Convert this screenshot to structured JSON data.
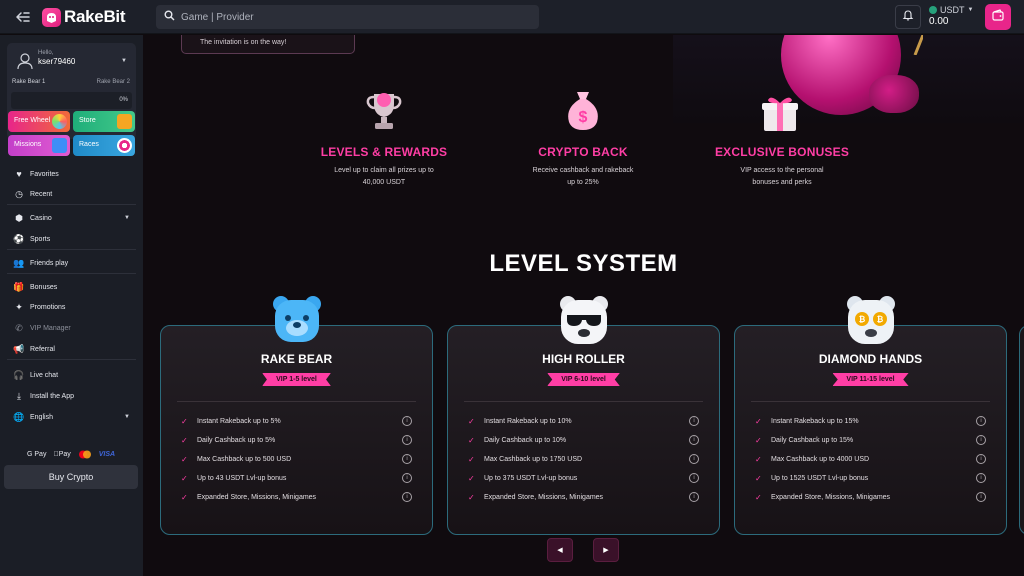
{
  "header": {
    "brand": "RakeBit",
    "search_placeholder": "Game | Provider",
    "currency": "USDT",
    "balance": "0.00"
  },
  "user": {
    "greeting": "Hello,",
    "username": "kser79460",
    "level_current": "Rake Bear 1",
    "level_next": "Rake Bear 2",
    "progress_pct": "0%",
    "progress_value": 0
  },
  "promos": {
    "free_wheel": "Free Wheel",
    "store": "Store",
    "missions": "Missions",
    "races": "Races"
  },
  "nav": {
    "favorites": "Favorites",
    "recent": "Recent",
    "casino": "Casino",
    "sports": "Sports",
    "friends_play": "Friends play",
    "bonuses": "Bonuses",
    "promotions": "Promotions",
    "vip_manager": "VIP Manager",
    "referral": "Referral",
    "live_chat": "Live chat",
    "install_app": "Install the App",
    "language": "English"
  },
  "payments": {
    "gpay": "G Pay",
    "applepay": "Pay",
    "visa": "VISA"
  },
  "buy_crypto": "Buy Crypto",
  "invite_text": "The invitation is on the way!",
  "features": [
    {
      "title": "LEVELS & REWARDS",
      "desc": "Level up to claim all prizes up to 40,000 USDT",
      "icon": "trophy-icon"
    },
    {
      "title": "CRYPTO BACK",
      "desc": "Receive cashback and rakeback up to 25%",
      "icon": "money-bag-icon"
    },
    {
      "title": "EXCLUSIVE BONUSES",
      "desc": "VIP access to the personal bonuses and perks",
      "icon": "gift-icon"
    }
  ],
  "level_system_title": "LEVEL SYSTEM",
  "tiers": [
    {
      "name": "RAKE BEAR",
      "badge": "VIP 1-5 level",
      "perks": [
        "Instant Rakeback up to 5%",
        "Daily Cashback up to 5%",
        "Max Cashback up to 500 USD",
        "Up to 43 USDT Lvl-up bonus",
        "Expanded Store, Missions, Minigames"
      ]
    },
    {
      "name": "HIGH ROLLER",
      "badge": "VIP 6-10 level",
      "perks": [
        "Instant Rakeback up to 10%",
        "Daily Cashback up to 10%",
        "Max Cashback up to 1750 USD",
        "Up to 375 USDT Lvl-up bonus",
        "Expanded Store, Missions, Minigames"
      ]
    },
    {
      "name": "DIAMOND HANDS",
      "badge": "VIP 11-15 level",
      "perks": [
        "Instant Rakeback up to 15%",
        "Daily Cashback up to 15%",
        "Max Cashback up to 4000 USD",
        "Up to 1525 USDT Lvl-up bonus",
        "Expanded Store, Missions, Minigames"
      ]
    }
  ],
  "colors": {
    "accent": "#ff3ea5",
    "brand_pink": "#e8258a",
    "card_border": "#2c6b7c",
    "sidebar_bg": "#1b1e26"
  }
}
